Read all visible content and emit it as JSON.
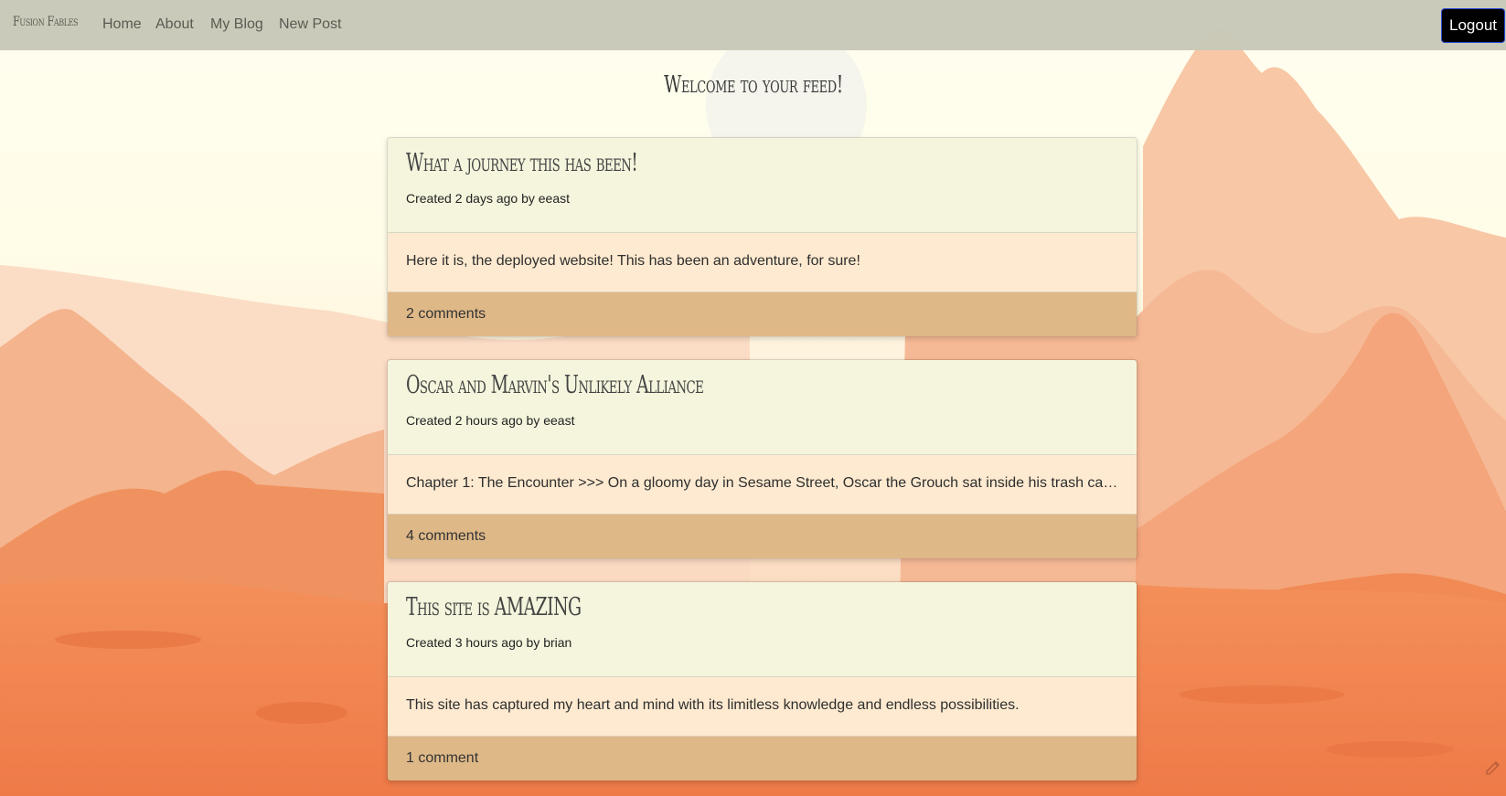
{
  "nav": {
    "brand": "Fusion Fables",
    "links": [
      "Home",
      "About",
      "My Blog",
      "New Post"
    ],
    "logout": "Logout"
  },
  "feed": {
    "title": "Welcome to your feed!",
    "posts": [
      {
        "title": "What a journey this has been!",
        "meta": "Created 2 days ago by eeast",
        "excerpt": "Here it is, the deployed website! This has been an adventure, for sure!",
        "comments": "2 comments"
      },
      {
        "title": "Oscar and Marvin's Unlikely Alliance",
        "meta": "Created 2 hours ago by eeast",
        "excerpt": "Chapter 1: The Encounter >>> On a gloomy day in Sesame Street, Oscar the Grouch sat inside his trash can, ...",
        "comments": "4 comments"
      },
      {
        "title": "This site is AMAZING",
        "meta": "Created 3 hours ago by brian",
        "excerpt": "This site has captured my heart and mind with its limitless knowledge and endless possibilities.",
        "comments": "1 comment"
      }
    ]
  },
  "colors": {
    "navbar": "#c8c8b7",
    "card_header": "#f5f5dd",
    "card_body": "#feead0",
    "card_footer": "#deb887",
    "logout_bg": "#000000"
  },
  "icons": {
    "corner": "pencil-icon"
  }
}
